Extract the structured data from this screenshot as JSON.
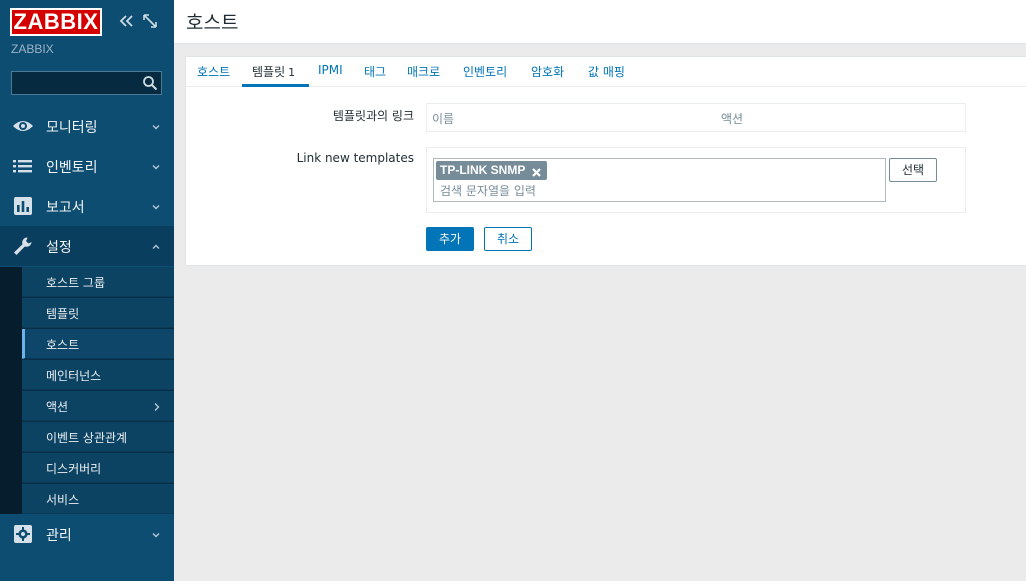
{
  "sidebar": {
    "logo": "ZABBIX",
    "server_name": "ZABBIX",
    "search": {
      "value": "",
      "placeholder": ""
    },
    "menu": [
      {
        "label": "모니터링",
        "icon": "eye-icon"
      },
      {
        "label": "인벤토리",
        "icon": "list-icon"
      },
      {
        "label": "보고서",
        "icon": "bar-chart-icon"
      },
      {
        "label": "설정",
        "icon": "wrench-icon",
        "active": true
      },
      {
        "label": "관리",
        "icon": "gear-icon"
      }
    ],
    "submenu": [
      {
        "label": "호스트 그룹"
      },
      {
        "label": "템플릿"
      },
      {
        "label": "호스트",
        "selected": true
      },
      {
        "label": "메인터넌스"
      },
      {
        "label": "액션",
        "has_children": true
      },
      {
        "label": "이벤트 상관관계"
      },
      {
        "label": "디스커버리"
      },
      {
        "label": "서비스"
      }
    ]
  },
  "header": {
    "title": "호스트"
  },
  "tabs": [
    {
      "label": "호스트"
    },
    {
      "label": "템플릿",
      "count": "1",
      "active": true
    },
    {
      "label": "IPMI"
    },
    {
      "label": "태그"
    },
    {
      "label": "매크로"
    },
    {
      "label": "인벤토리"
    },
    {
      "label": "암호화"
    },
    {
      "label": "값 매핑"
    }
  ],
  "form": {
    "linked_templates_label": "템플릿과의 링크",
    "linked_table_headers": {
      "name": "이름",
      "action": "액션"
    },
    "link_new_label": "Link new templates",
    "selected_templates": [
      "TP-LINK SNMP"
    ],
    "search_placeholder": "검색 문자열을 입력",
    "select_button": "선택",
    "add_button": "추가",
    "cancel_button": "취소"
  },
  "colors": {
    "sidebar_bg": "#0e4d72",
    "logo_red": "#d40000",
    "accent_blue": "#0275b8",
    "page_bg": "#ebebeb"
  }
}
